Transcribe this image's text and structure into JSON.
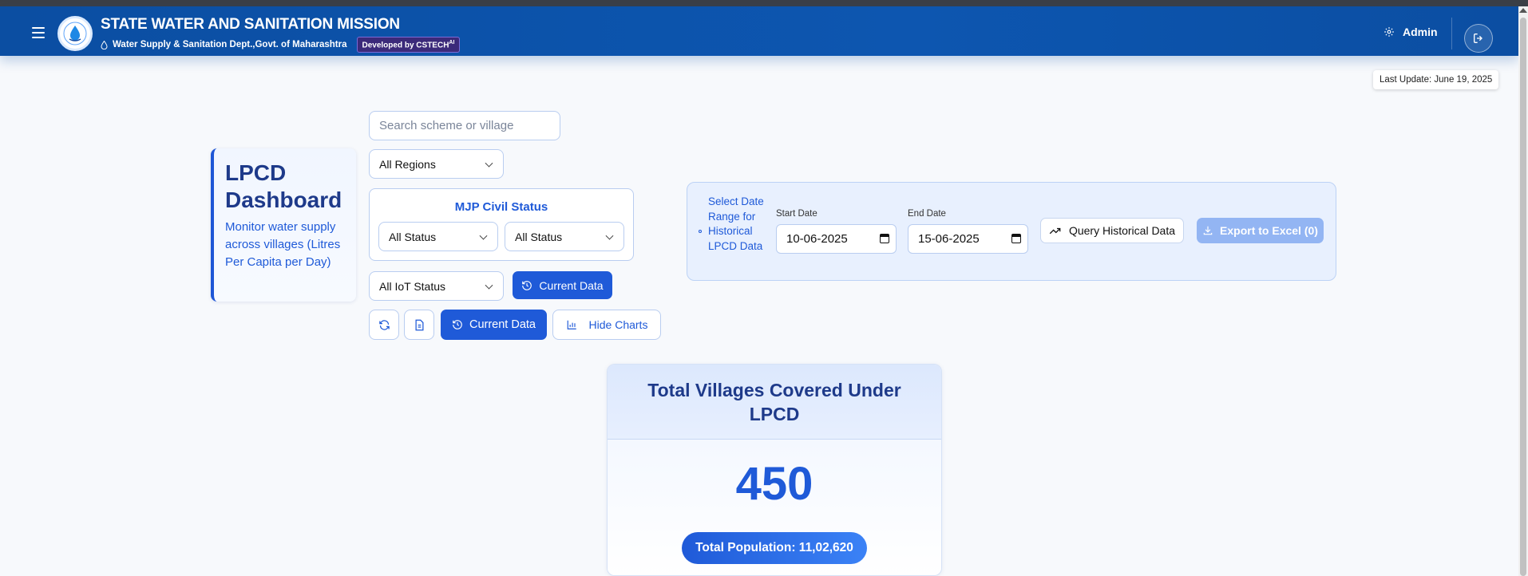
{
  "header": {
    "title": "STATE WATER AND SANITATION MISSION",
    "subtitle": "Water Supply & Sanitation Dept.,Govt. of Maharashtra",
    "dev_badge": "Developed by CSTECH",
    "dev_badge_sup": "AI",
    "admin_label": "Admin",
    "icons": {
      "menu": "hamburger-icon",
      "logo": "water-drop-logo",
      "settings": "gear-icon",
      "logout": "logout-icon"
    }
  },
  "last_update": "Last Update: June 19, 2025",
  "dashboard": {
    "title": "LPCD Dashboard",
    "description": "Monitor water supply across villages (Litres Per Capita per Day)"
  },
  "filters": {
    "search_placeholder": "Search scheme or village",
    "region": "All Regions",
    "civil_status_title": "MJP Civil Status",
    "civil_status_1": "All Status",
    "civil_status_2": "All Status",
    "iot_status": "All IoT Status",
    "current_data_label": "Current Data",
    "current_data_label_2": "Current Data",
    "hide_charts_label": "Hide Charts"
  },
  "historical": {
    "label": "Select Date Range for Historical LPCD Data",
    "start_label": "Start Date",
    "start_value": "10-06-2025",
    "end_label": "End Date",
    "end_value": "15-06-2025",
    "query_label": "Query Historical Data",
    "export_label": "Export to Excel (0)"
  },
  "stats": {
    "title": "Total Villages Covered Under LPCD",
    "villages": "450",
    "population": "Total Population: 11,02,620"
  },
  "colors": {
    "header": "#0b4ea2",
    "accent": "#1f5ad8",
    "accent_dark": "#1e3a8a",
    "disabled_button": "#93b5f3"
  }
}
